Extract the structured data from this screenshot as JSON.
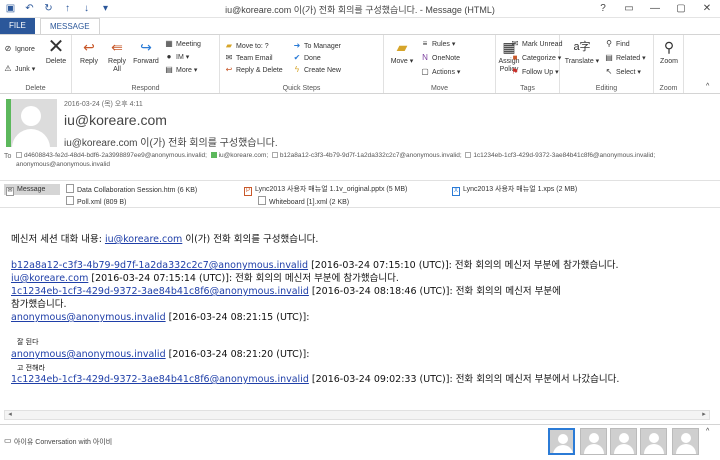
{
  "window": {
    "title": "iu@koreare.com 이(가) 전화 회의를 구성했습니다. - Message (HTML)",
    "controls": [
      "?",
      "▭",
      "—",
      "▢",
      "✕"
    ]
  },
  "tabs": {
    "file": "FILE",
    "message": "MESSAGE"
  },
  "ribbon": {
    "delete": {
      "ignore": "Ignore",
      "junk": "Junk",
      "delete": "Delete",
      "label": "Delete"
    },
    "respond": {
      "reply": "Reply",
      "reply_all": "Reply\nAll",
      "forward": "Forward",
      "meeting": "Meeting",
      "im": "IM",
      "more": "More",
      "label": "Respond"
    },
    "quick_steps": {
      "items": [
        "Move to: ?",
        "To Manager",
        "Team Email",
        "Done",
        "Reply & Delete",
        "Create New"
      ],
      "label": "Quick Steps"
    },
    "move": {
      "move": "Move",
      "rules": "Rules",
      "onenote": "OneNote",
      "actions": "Actions",
      "label": "Move"
    },
    "tags": {
      "assign_policy": "Assign\nPolicy",
      "mark_unread": "Mark Unread",
      "categorize": "Categorize",
      "follow_up": "Follow Up",
      "label": "Tags"
    },
    "editing": {
      "translate": "Translate",
      "find": "Find",
      "related": "Related",
      "select": "Select",
      "label": "Editing"
    },
    "zoom": {
      "zoom": "Zoom",
      "label": "Zoom"
    }
  },
  "header": {
    "date": "2016-03-24 (목) 오후 4:11",
    "from": "iu@koreare.com",
    "subject": "iu@koreare.com 이(가) 전화 회의를 구성했습니다.",
    "to_label": "To",
    "recipients": [
      "d4608843-fe2d-48d4-bdf6-2a3998897ee9@anonymous.invalid;",
      "iu@koreare.com;",
      "b12a8a12-c3f3-4b79-9d7f-1a2da332c2c7@anonymous.invalid;",
      "1c1234eb-1cf3-429d-9372-3ae84b41c8f6@anonymous.invalid;",
      "anonymous@anonymous.invalid"
    ]
  },
  "attachments": {
    "message": "Message",
    "items": [
      "Data Collaboration Session.htm (6 KB)",
      "Lync2013 사용자 매뉴얼 1.1v_original.pptx (5 MB)",
      "Lync2013 사용자 매뉴얼 1.xps (2 MB)",
      "Poll.xml (809 B)",
      "Whiteboard [1].xml (2 KB)"
    ]
  },
  "body": {
    "intro_prefix": "메신저 세션 대화 내용: ",
    "intro_link": "iu@koreare.com",
    "intro_suffix": " 이(가) 전화 회의를 구성했습니다.",
    "l1_link": "b12a8a12-c3f3-4b79-9d7f-1a2da332c2c7@anonymous.invalid",
    "l1_text": " [2016-03-24 07:15:10 (UTC)]: 전화 회의의 메신저 부분에 참가했습니다.",
    "l2_link": "iu@koreare.com",
    "l2_text": " [2016-03-24 07:15:14 (UTC)]: 전화 회의의 메신저 부분에 참가했습니다.",
    "l3_link": "1c1234eb-1cf3-429d-9372-3ae84b41c8f6@anonymous.invalid",
    "l3_text": " [2016-03-24 08:18:46 (UTC)]: 전화 회의의 메신저 부분에",
    "l3_cont": "참가했습니다.",
    "l4_link": "anonymous@anonymous.invalid",
    "l4_text": " [2016-03-24 08:21:15 (UTC)]:",
    "l4_msg": "잘 된다",
    "l5_link": "anonymous@anonymous.invalid",
    "l5_text": " [2016-03-24 08:21:20 (UTC)]:",
    "l5_msg": "고 전해라",
    "l6_link": "1c1234eb-1cf3-429d-9372-3ae84b41c8f6@anonymous.invalid",
    "l6_text": " [2016-03-24 09:02:33 (UTC)]: 전화 회의의 메신저 부분에서 나갔습니다."
  },
  "people_pane": {
    "text": "아이유  Conversation with 아이비"
  }
}
